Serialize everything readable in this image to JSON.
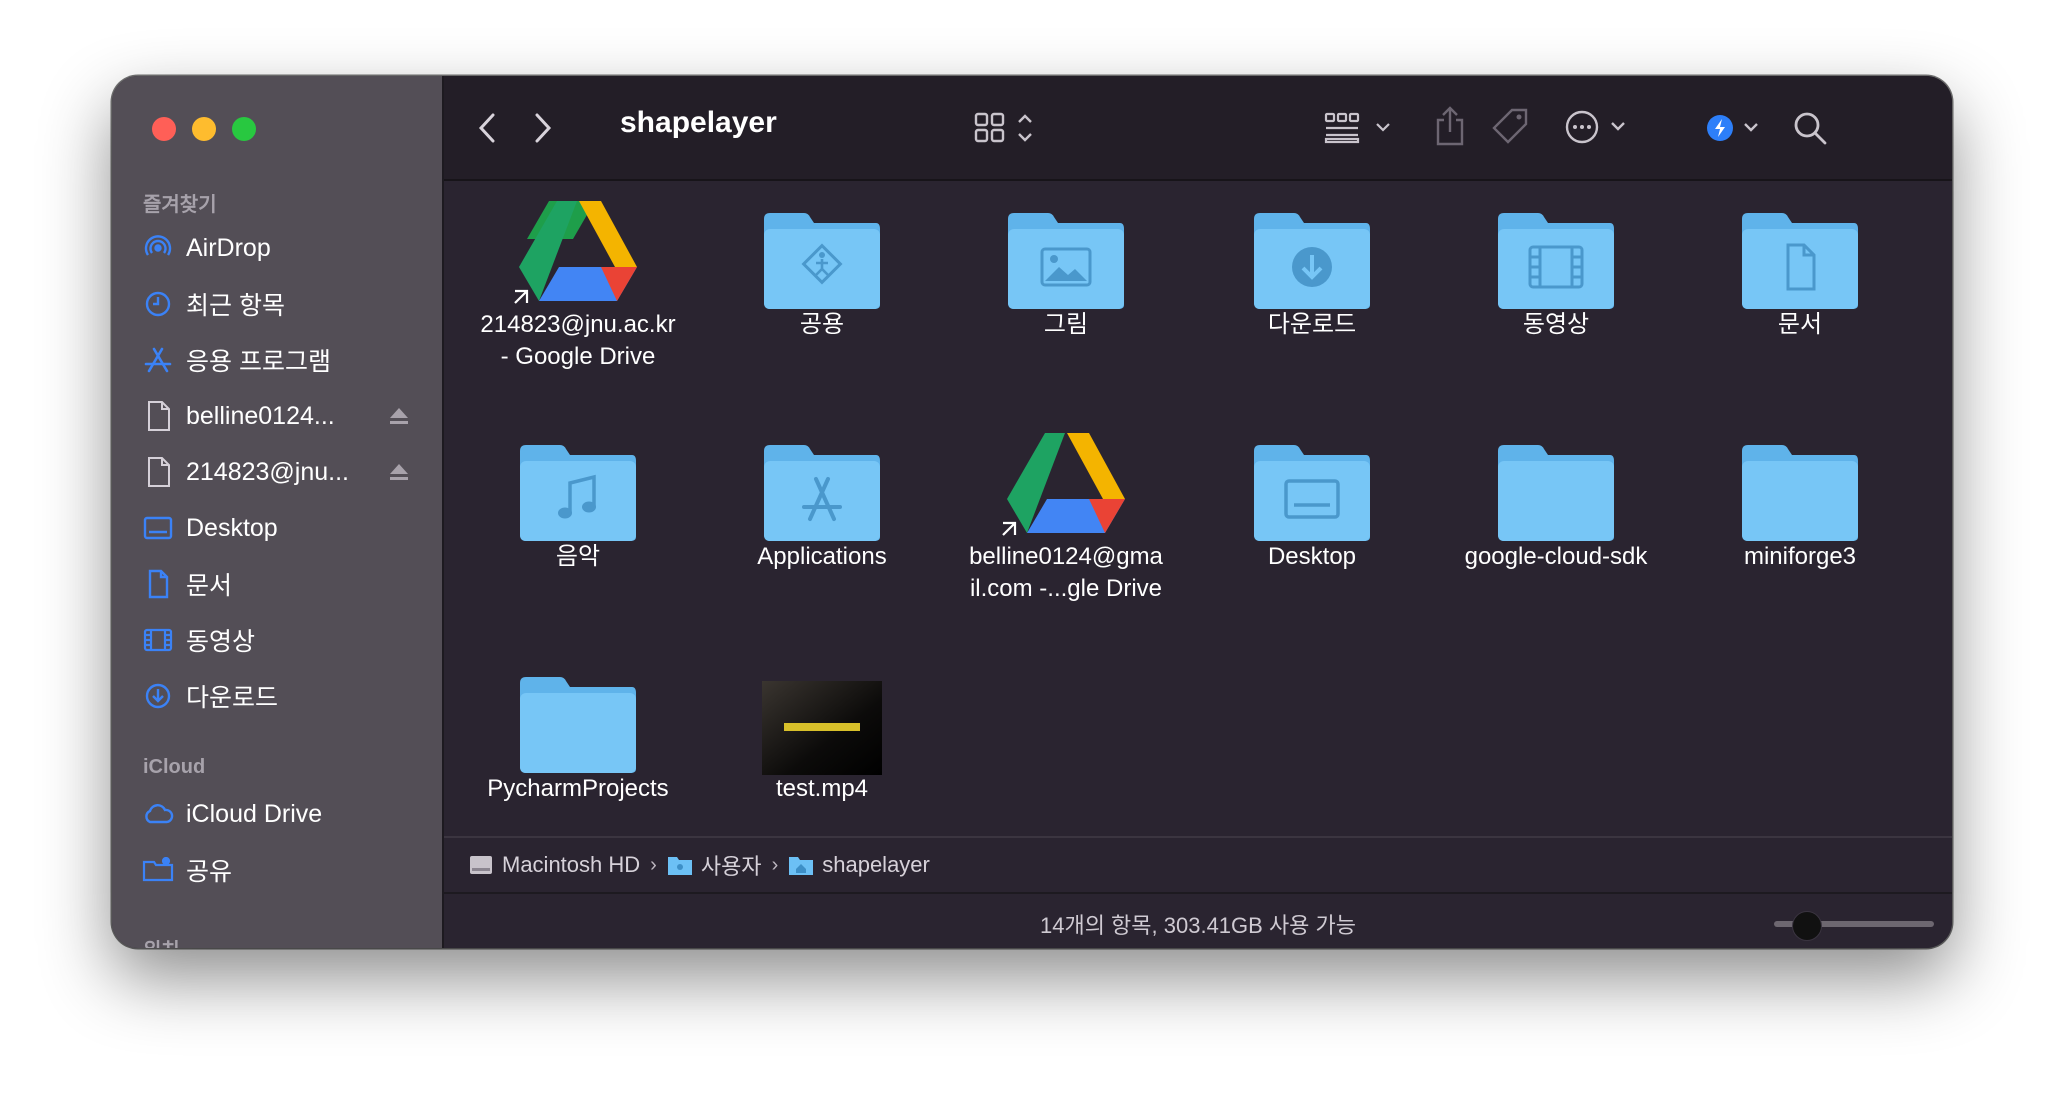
{
  "window": {
    "title": "shapelayer"
  },
  "sidebar": {
    "favorites_header": "즐겨찾기",
    "favorites": [
      {
        "label": "AirDrop",
        "icon": "airdrop-icon"
      },
      {
        "label": "최근 항목",
        "icon": "clock-icon"
      },
      {
        "label": "응용 프로그램",
        "icon": "applications-icon"
      },
      {
        "label": "belline0124...",
        "icon": "document-icon",
        "eject": true
      },
      {
        "label": "214823@jnu...",
        "icon": "document-icon",
        "eject": true
      },
      {
        "label": "Desktop",
        "icon": "desktop-icon"
      },
      {
        "label": "문서",
        "icon": "document-icon"
      },
      {
        "label": "동영상",
        "icon": "film-icon"
      },
      {
        "label": "다운로드",
        "icon": "download-icon"
      }
    ],
    "icloud_header": "iCloud",
    "icloud": [
      {
        "label": "iCloud Drive",
        "icon": "cloud-icon"
      },
      {
        "label": "공유",
        "icon": "shared-folder-icon"
      }
    ],
    "locations_header": "위치"
  },
  "files": [
    {
      "name": "214823@jnu.ac.kr\n- Google Drive",
      "type": "gdrive"
    },
    {
      "name": "공용",
      "type": "folder-public"
    },
    {
      "name": "그림",
      "type": "folder-pictures"
    },
    {
      "name": "다운로드",
      "type": "folder-downloads"
    },
    {
      "name": "동영상",
      "type": "folder-movies"
    },
    {
      "name": "문서",
      "type": "folder-documents"
    },
    {
      "name": "음악",
      "type": "folder-music"
    },
    {
      "name": "Applications",
      "type": "folder-applications"
    },
    {
      "name": "belline0124@gma\nil.com -...gle Drive",
      "type": "gdrive"
    },
    {
      "name": "Desktop",
      "type": "folder-desktop"
    },
    {
      "name": "google-cloud-sdk",
      "type": "folder"
    },
    {
      "name": "miniforge3",
      "type": "folder"
    },
    {
      "name": "PycharmProjects",
      "type": "folder"
    },
    {
      "name": "test.mp4",
      "type": "video"
    }
  ],
  "path": [
    {
      "label": "Macintosh HD",
      "icon": "hard-drive-icon"
    },
    {
      "label": "사용자",
      "icon": "users-folder-icon"
    },
    {
      "label": "shapelayer",
      "icon": "home-folder-icon"
    }
  ],
  "status": {
    "text": "14개의 항목, 303.41GB 사용 가능"
  },
  "icon_size_slider": {
    "value_fraction": 0.2
  },
  "colors": {
    "folder": "#6cc0f5",
    "accent": "#2d7ff9",
    "sidebar_icon": "#3b82f6"
  }
}
